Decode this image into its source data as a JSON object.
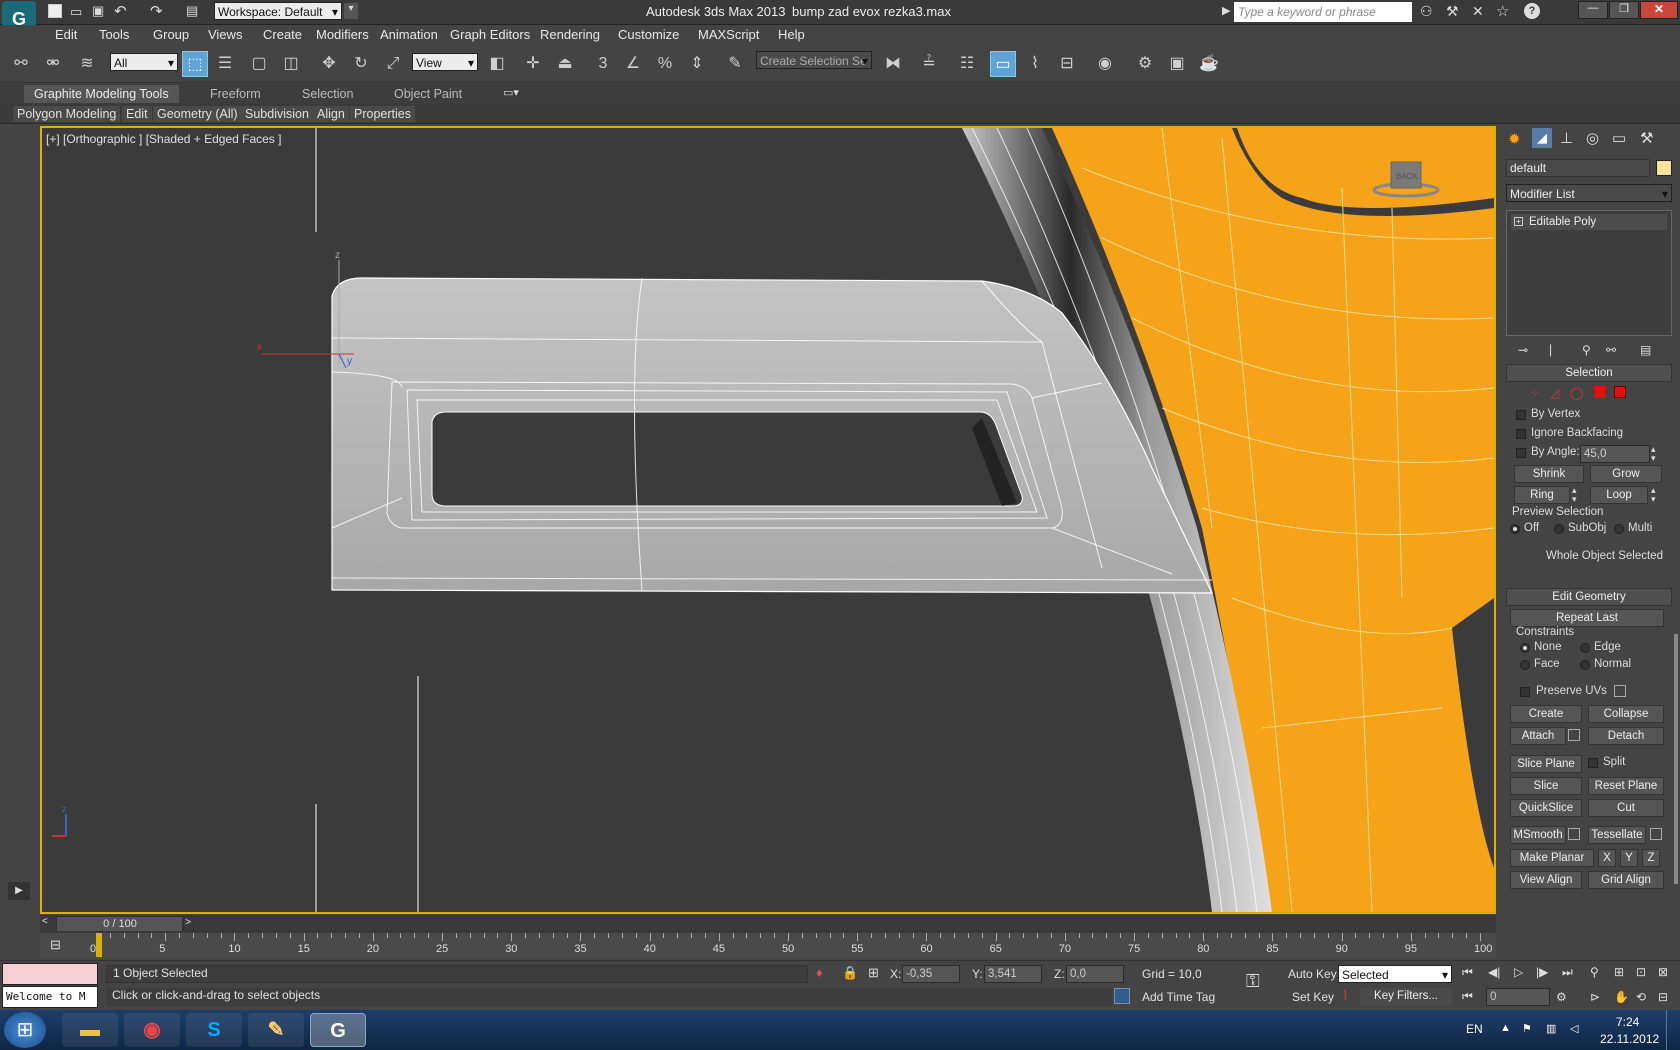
{
  "titlebar": {
    "workspace": "Workspace: Default",
    "app_title": "Autodesk 3ds Max  2013",
    "file_name": "bump zad evox rezka3.max",
    "search_placeholder": "Type a keyword or phrase"
  },
  "menu": [
    "Edit",
    "Tools",
    "Group",
    "Views",
    "Create",
    "Modifiers",
    "Animation",
    "Graph Editors",
    "Rendering",
    "Customize",
    "MAXScript",
    "Help"
  ],
  "toolbar": {
    "filter_value": "All",
    "refcoord_value": "View",
    "selection_set_value": "Create Selection Se",
    "snap_label": "3"
  },
  "ribbon": {
    "tabs": [
      "Graphite Modeling Tools",
      "Freeform",
      "Selection",
      "Object Paint"
    ],
    "panels": [
      "Polygon Modeling",
      "Edit",
      "Geometry (All)",
      "Subdivision",
      "Align",
      "Properties"
    ]
  },
  "viewport": {
    "label": "[+] [Orthographic ] [Shaded + Edged Faces ]",
    "viewcube_label": "BACK",
    "axis_x": "x",
    "axis_y": "y",
    "axis_z": "z"
  },
  "command_panel": {
    "object_name": "default",
    "modifier_list": "Modifier List",
    "stack_item": "Editable Poly",
    "selection_title": "Selection",
    "by_vertex": "By Vertex",
    "ignore_backfacing": "Ignore Backfacing",
    "by_angle": "By Angle:",
    "by_angle_value": "45,0",
    "shrink": "Shrink",
    "grow": "Grow",
    "ring": "Ring",
    "loop": "Loop",
    "preview_selection": "Preview Selection",
    "preview_off": "Off",
    "preview_subobj": "SubObj",
    "preview_multi": "Multi",
    "whole_object": "Whole Object Selected",
    "edit_geometry_title": "Edit Geometry",
    "repeat_last": "Repeat Last",
    "constraints": "Constraints",
    "c_none": "None",
    "c_edge": "Edge",
    "c_face": "Face",
    "c_normal": "Normal",
    "preserve_uvs": "Preserve UVs",
    "create": "Create",
    "collapse": "Collapse",
    "attach": "Attach",
    "detach": "Detach",
    "slice_plane": "Slice Plane",
    "split": "Split",
    "slice": "Slice",
    "reset_plane": "Reset Plane",
    "quickslice": "QuickSlice",
    "cut": "Cut",
    "msmooth": "MSmooth",
    "tessellate": "Tessellate",
    "make_planar": "Make Planar",
    "x": "X",
    "y": "Y",
    "z": "Z",
    "view_align": "View Align",
    "grid_align": "Grid Align"
  },
  "timeline": {
    "frame": "0 / 100",
    "ticks": [
      "0",
      "5",
      "10",
      "15",
      "20",
      "25",
      "30",
      "35",
      "40",
      "45",
      "50",
      "55",
      "60",
      "65",
      "70",
      "75",
      "80",
      "85",
      "90",
      "95",
      "100"
    ]
  },
  "status": {
    "maxscript_listener": "Welcome to M",
    "selected": "1 Object Selected",
    "prompt": "Click or click-and-drag to select objects",
    "x_label": "X:",
    "x_value": "-0,35",
    "y_label": "Y:",
    "y_value": "3,541",
    "z_label": "Z:",
    "z_value": "0,0",
    "grid": "Grid = 10,0",
    "add_time_tag": "Add Time Tag",
    "auto_key": "Auto Key",
    "set_key": "Set Key",
    "key_mode": "Selected",
    "key_filters": "Key Filters...",
    "frame_value": "0"
  },
  "taskbar": {
    "lang": "EN",
    "time": "7:24",
    "date": "22.11.2012"
  },
  "colors": {
    "viewport_border": "#d9b100",
    "object_orange": "#f5a319",
    "object_grey": "#b8b8b8",
    "active_tool": "#5fa3d8"
  }
}
